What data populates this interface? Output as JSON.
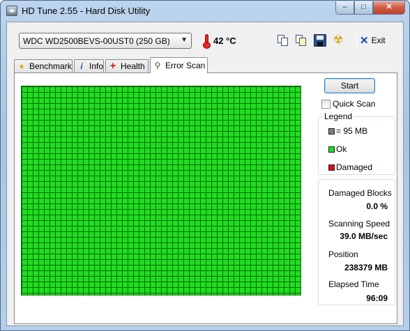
{
  "window": {
    "title": "HD Tune 2.55 - Hard Disk Utility",
    "controls": {
      "minimize": "–",
      "maximize": "□",
      "close": "✕"
    }
  },
  "toolbar": {
    "drive": "WDC WD2500BEVS-00UST0 (250 GB)",
    "temperature": "42 °C",
    "exit_label": "Exit",
    "icons": [
      "copy-text-icon",
      "copy-screenshot-icon",
      "save-icon",
      "hazard-icon",
      "exit-icon"
    ]
  },
  "tabs": [
    {
      "label": "Benchmark",
      "icon": "benchmark-icon",
      "active": false
    },
    {
      "label": "Info",
      "icon": "info-icon",
      "active": false
    },
    {
      "label": "Health",
      "icon": "health-icon",
      "active": false
    },
    {
      "label": "Error Scan",
      "icon": "error-scan-icon",
      "active": true
    }
  ],
  "scan": {
    "start_label": "Start",
    "quick_scan_label": "Quick Scan",
    "quick_scan_checked": false,
    "block_status": "all ok",
    "colors": {
      "ok": "#20dd20",
      "damaged": "#dd1111",
      "block_size": "#808080"
    }
  },
  "legend": {
    "title": "Legend",
    "items": [
      {
        "label": "= 95 MB",
        "color": "#808080"
      },
      {
        "label": "Ok",
        "color": "#20dd20"
      },
      {
        "label": "Damaged",
        "color": "#dd1111"
      }
    ]
  },
  "stats": {
    "damaged_blocks_label": "Damaged Blocks",
    "damaged_blocks_value": "0.0 %",
    "speed_label": "Scanning Speed",
    "speed_value": "39.0 MB/sec",
    "position_label": "Position",
    "position_value": "238379 MB",
    "elapsed_label": "Elapsed Time",
    "elapsed_value": "96:09"
  }
}
